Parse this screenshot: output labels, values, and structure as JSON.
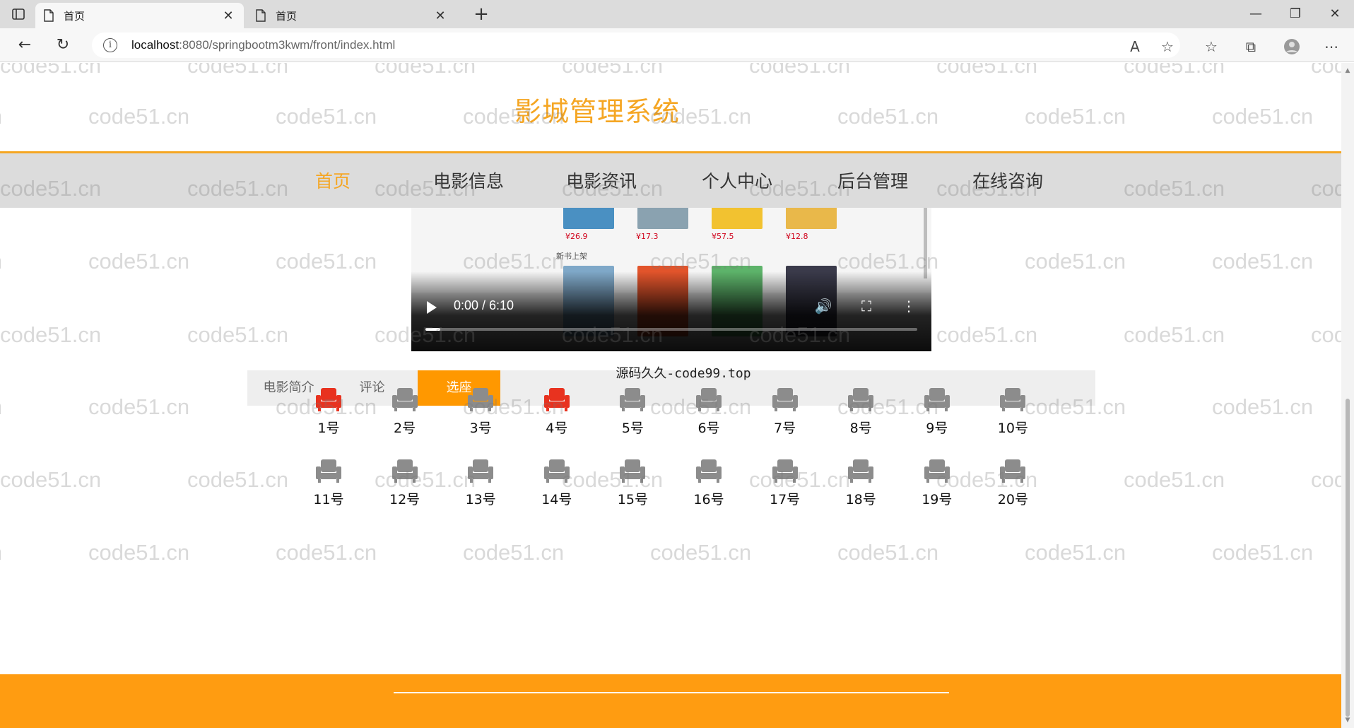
{
  "browser": {
    "tabs": [
      {
        "title": "首页",
        "active": true
      },
      {
        "title": "首页",
        "active": false
      }
    ],
    "url_host": "localhost",
    "url_path": ":8080/springbootm3kwm/front/index.html"
  },
  "site": {
    "title": "影城管理系统",
    "nav": [
      {
        "label": "首页",
        "active": true
      },
      {
        "label": "电影信息",
        "active": false
      },
      {
        "label": "电影资讯",
        "active": false
      },
      {
        "label": "个人中心",
        "active": false
      },
      {
        "label": "后台管理",
        "active": false
      },
      {
        "label": "在线咨询",
        "active": false
      }
    ]
  },
  "video": {
    "time": "0:00 / 6:10",
    "progress": 0.03,
    "preview_section_label": "新书上架",
    "preview_prices": [
      "¥26.9",
      "¥17.3",
      "¥57.5",
      "¥12.8"
    ]
  },
  "caption": "源码久久-code99.top",
  "detail_tabs": [
    {
      "label": "电影简介",
      "active": false
    },
    {
      "label": "评论",
      "active": false
    },
    {
      "label": "选座",
      "active": true
    }
  ],
  "seats": [
    {
      "label": "1号",
      "selected": true
    },
    {
      "label": "2号",
      "selected": false
    },
    {
      "label": "3号",
      "selected": false
    },
    {
      "label": "4号",
      "selected": true
    },
    {
      "label": "5号",
      "selected": false
    },
    {
      "label": "6号",
      "selected": false
    },
    {
      "label": "7号",
      "selected": false
    },
    {
      "label": "8号",
      "selected": false
    },
    {
      "label": "9号",
      "selected": false
    },
    {
      "label": "10号",
      "selected": false
    },
    {
      "label": "11号",
      "selected": false
    },
    {
      "label": "12号",
      "selected": false
    },
    {
      "label": "13号",
      "selected": false
    },
    {
      "label": "14号",
      "selected": false
    },
    {
      "label": "15号",
      "selected": false
    },
    {
      "label": "16号",
      "selected": false
    },
    {
      "label": "17号",
      "selected": false
    },
    {
      "label": "18号",
      "selected": false
    },
    {
      "label": "19号",
      "selected": false
    },
    {
      "label": "20号",
      "selected": false
    }
  ],
  "watermark_text": "code51.cn",
  "colors": {
    "accent": "#f5a623",
    "footer": "#ff9c11",
    "seat_selected": "#e8321f",
    "seat_free": "#8c8c8c"
  }
}
